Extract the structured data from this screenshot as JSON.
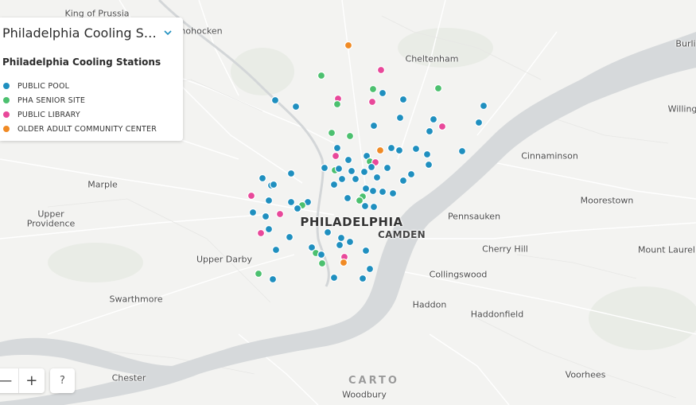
{
  "panel": {
    "title": "Philadelphia Cooling Sta…",
    "subtitle": "Philadelphia Cooling Stations",
    "legend": [
      {
        "label": "PUBLIC POOL",
        "color": "#1f8fbf"
      },
      {
        "label": "PHA SENIOR SITE",
        "color": "#4cc06f"
      },
      {
        "label": "PUBLIC LIBRARY",
        "color": "#e8489a"
      },
      {
        "label": "OLDER ADULT COMMUNITY CENTER",
        "color": "#f08a24"
      }
    ]
  },
  "controls": {
    "zoom_out": "—",
    "zoom_in": "+",
    "help": "?"
  },
  "attribution": "CARTO",
  "places": {
    "king_of_prussia": "King of Prussia",
    "conshohocken": "nohocken",
    "cheltenham": "Cheltenham",
    "burlington": "Burli",
    "willingboro": "Willing",
    "cinnaminson": "Cinnaminson",
    "marple": "Marple",
    "upper_providence_1": "Upper",
    "upper_providence_2": "Providence",
    "philadelphia": "PHILADELPHIA",
    "camden": "CAMDEN",
    "pennsauken": "Pennsauken",
    "moorestown": "Moorestown",
    "upper_darby": "Upper Darby",
    "cherry_hill": "Cherry Hill",
    "mount_laurel": "Mount Laurel",
    "collingswood": "Collingswood",
    "swarthmore": "Swarthmore",
    "haddon": "Haddon",
    "haddonfield": "Haddonfield",
    "chester": "Chester",
    "voorhees": "Voorhees",
    "woodbury": "Woodbury"
  }
}
